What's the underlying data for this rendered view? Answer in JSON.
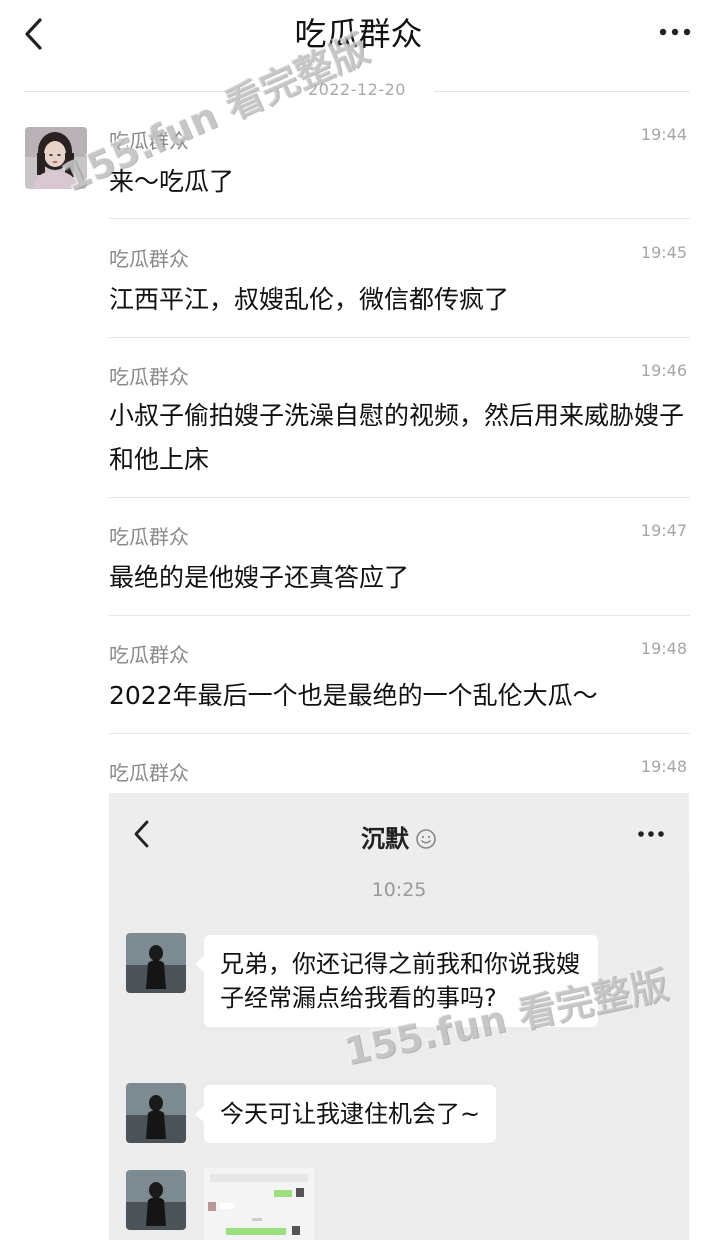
{
  "header": {
    "title": "吃瓜群众"
  },
  "date_divider": "2022-12-20",
  "messages": [
    {
      "sender": "吃瓜群众",
      "time": "19:44",
      "text": "来～吃瓜了"
    },
    {
      "sender": "吃瓜群众",
      "time": "19:45",
      "text": "江西平江，叔嫂乱伦，微信都传疯了"
    },
    {
      "sender": "吃瓜群众",
      "time": "19:46",
      "text": "小叔子偷拍嫂子洗澡自慰的视频，然后用来威胁嫂子和他上床"
    },
    {
      "sender": "吃瓜群众",
      "time": "19:47",
      "text": "最绝的是他嫂子还真答应了"
    },
    {
      "sender": "吃瓜群众",
      "time": "19:48",
      "text": "2022年最后一个也是最绝的一个乱伦大瓜～"
    },
    {
      "sender": "吃瓜群众",
      "time": "19:48"
    }
  ],
  "embedded_chat": {
    "title": "沉默",
    "time": "10:25",
    "bubbles": [
      {
        "text": "兄弟，你还记得之前我和你说我嫂子经常漏点给我看的事吗?"
      },
      {
        "text": "今天可让我逮住机会了~"
      }
    ]
  },
  "watermarks": [
    "155.fun 看完整版",
    "155.fun 看完整版"
  ],
  "icons": {
    "back": "chevron-left-icon",
    "more": "more-dots-icon",
    "emoji": "smiley-icon"
  },
  "colors": {
    "background": "#ffffff",
    "meta_text": "#8a8a8a",
    "divider": "#e6e6e6",
    "embed_background": "#ececec"
  }
}
